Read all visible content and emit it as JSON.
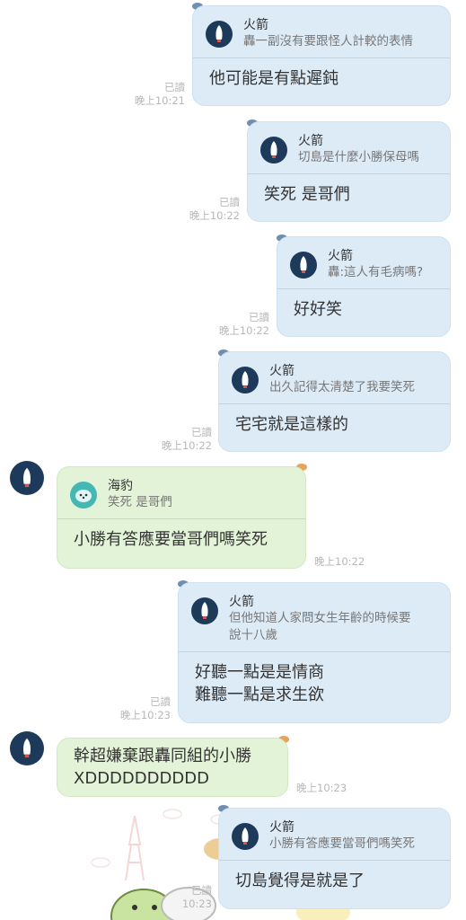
{
  "messages": [
    {
      "quote_name": "火箭",
      "quote_text": "轟一副沒有要跟怪人計較的表情",
      "text": "他可能是有點遲鈍",
      "read": "已讀",
      "time": "晚上10:21"
    },
    {
      "quote_name": "火箭",
      "quote_text": "切島是什麼小勝保母嗎",
      "text": "笑死 是哥們",
      "read": "已讀",
      "time": "晚上10:22"
    },
    {
      "quote_name": "火箭",
      "quote_text": "轟:這人有毛病嗎?",
      "text": "好好笑",
      "read": "已讀",
      "time": "晚上10:22"
    },
    {
      "quote_name": "火箭",
      "quote_text": "出久記得太清楚了我要笑死",
      "text": "宅宅就是這樣的",
      "read": "已讀",
      "time": "晚上10:22"
    },
    {
      "quote_name": "海豹",
      "quote_text": "笑死 是哥們",
      "text": "小勝有答應要當哥們嗎笑死",
      "time": "晚上10:22"
    },
    {
      "quote_name": "火箭",
      "quote_text_1": "但他知道人家問女生年齡的時候要",
      "quote_text_2": "說十八歲",
      "text_1": "好聽一點是是情商",
      "text_2": "難聽一點是求生欲",
      "read": "已讀",
      "time": "晚上10:23"
    },
    {
      "text_1": "幹超嫌棄跟轟同組的小勝",
      "text_2": "XDDDDDDDDDD",
      "time": "晚上10:23"
    },
    {
      "quote_name": "火箭",
      "quote_text": "小勝有答應要當哥們嗎笑死",
      "text": "切島覺得是就是了",
      "read": "已讀",
      "time": "10:23"
    }
  ],
  "icons": {
    "rocket": "rocket-icon",
    "seal": "seal-icon"
  },
  "colors": {
    "outgoing": "#ddebf7",
    "incoming": "#e3f3d7",
    "rocket_bg": "#1d3a5a",
    "seal_bg": "#45b8b4"
  }
}
